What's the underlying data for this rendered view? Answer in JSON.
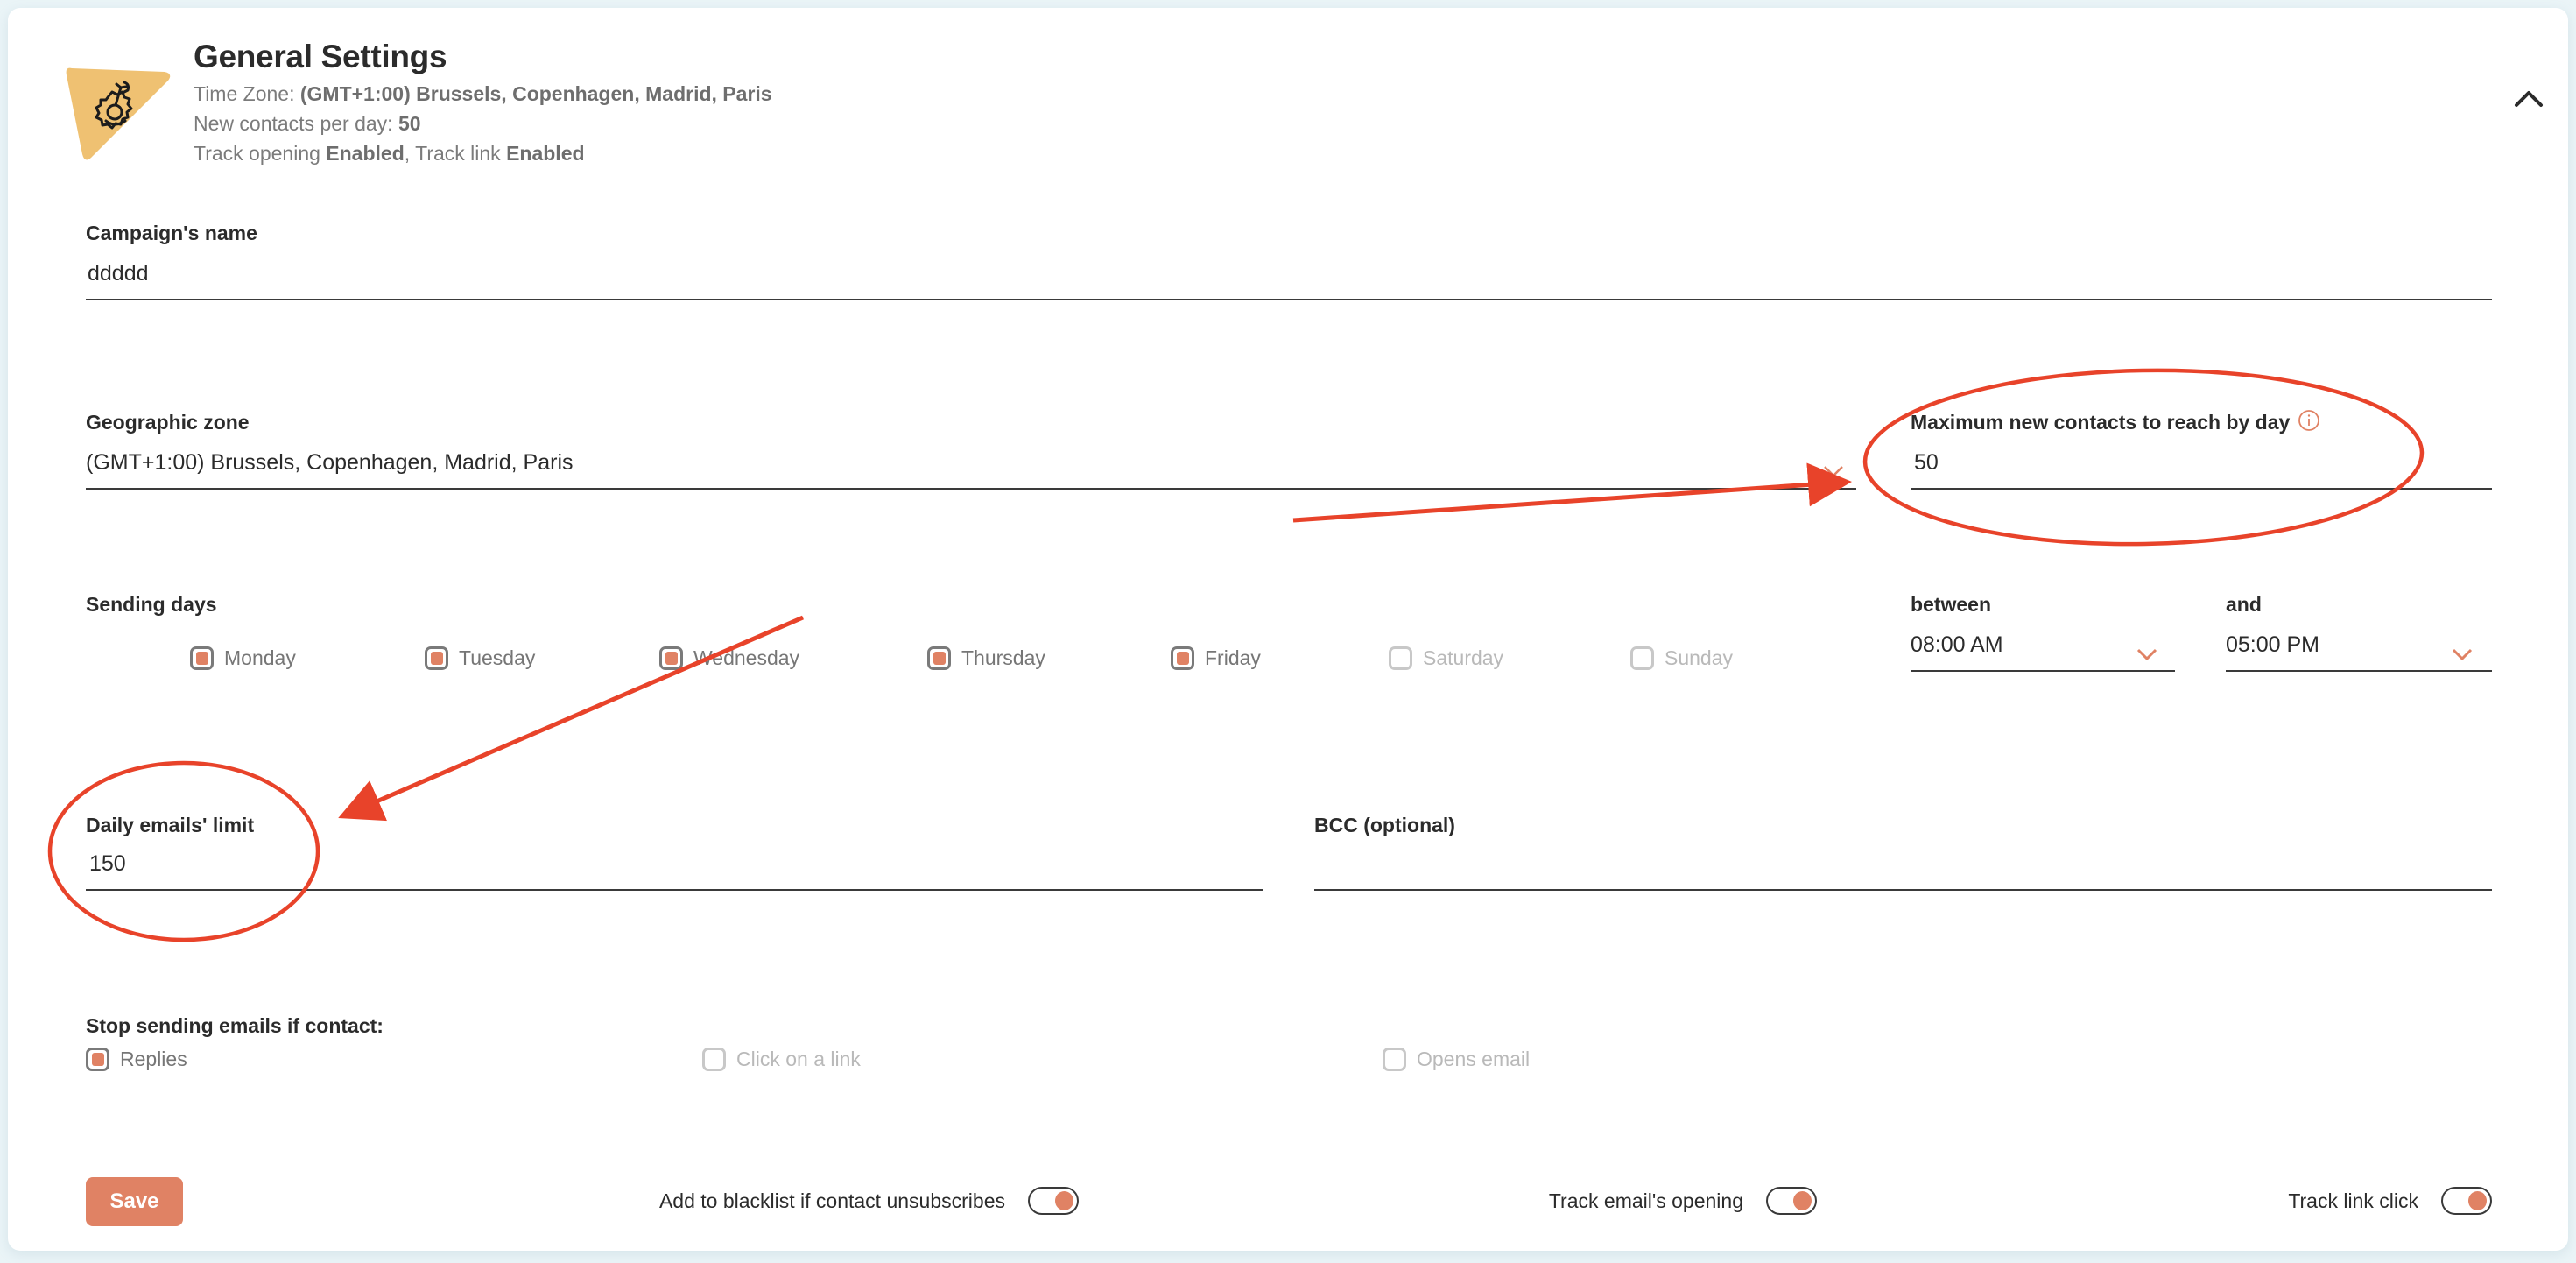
{
  "header": {
    "title": "General Settings",
    "icon": "settings-wrench-gear-icon",
    "summary": {
      "timezone_prefix": "Time Zone: ",
      "timezone_value": "(GMT+1:00) Brussels, Copenhagen, Madrid, Paris",
      "contacts_prefix": "New contacts per day: ",
      "contacts_value": "50",
      "track_opening_prefix": "Track opening ",
      "track_opening_value": "Enabled",
      "track_link_prefix": ", Track link ",
      "track_link_value": "Enabled"
    },
    "collapse_icon": "chevron-up-icon"
  },
  "form": {
    "campaign_name": {
      "label": "Campaign's name",
      "value": "ddddd"
    },
    "geographic_zone": {
      "label": "Geographic zone",
      "value": "(GMT+1:00) Brussels, Copenhagen, Madrid, Paris"
    },
    "max_new_contacts": {
      "label": "Maximum new contacts to reach by day",
      "value": "50",
      "info_icon": "info-icon"
    },
    "sending_days": {
      "label": "Sending days",
      "days": [
        {
          "label": "Monday",
          "checked": true
        },
        {
          "label": "Tuesday",
          "checked": true
        },
        {
          "label": "Wednesday",
          "checked": true
        },
        {
          "label": "Thursday",
          "checked": true
        },
        {
          "label": "Friday",
          "checked": true
        },
        {
          "label": "Saturday",
          "checked": false
        },
        {
          "label": "Sunday",
          "checked": false
        }
      ]
    },
    "between": {
      "label": "between",
      "value": "08:00 AM"
    },
    "and": {
      "label": "and",
      "value": "05:00 PM"
    },
    "daily_limit": {
      "label": "Daily emails' limit",
      "value": "150"
    },
    "bcc": {
      "label": "BCC (optional)",
      "value": ""
    },
    "stop_sending": {
      "label": "Stop sending emails if contact:",
      "options": [
        {
          "label": "Replies",
          "checked": true
        },
        {
          "label": "Click on a link",
          "checked": false
        },
        {
          "label": "Opens email",
          "checked": false
        }
      ]
    }
  },
  "footer": {
    "save_label": "Save",
    "toggles": [
      {
        "label": "Add to blacklist if contact unsubscribes",
        "on": true
      },
      {
        "label": "Track email's opening",
        "on": true
      },
      {
        "label": "Track link click",
        "on": true
      }
    ]
  },
  "colors": {
    "accent": "#e08264",
    "icon_bg": "#efc172",
    "annotation": "#e8432a"
  }
}
